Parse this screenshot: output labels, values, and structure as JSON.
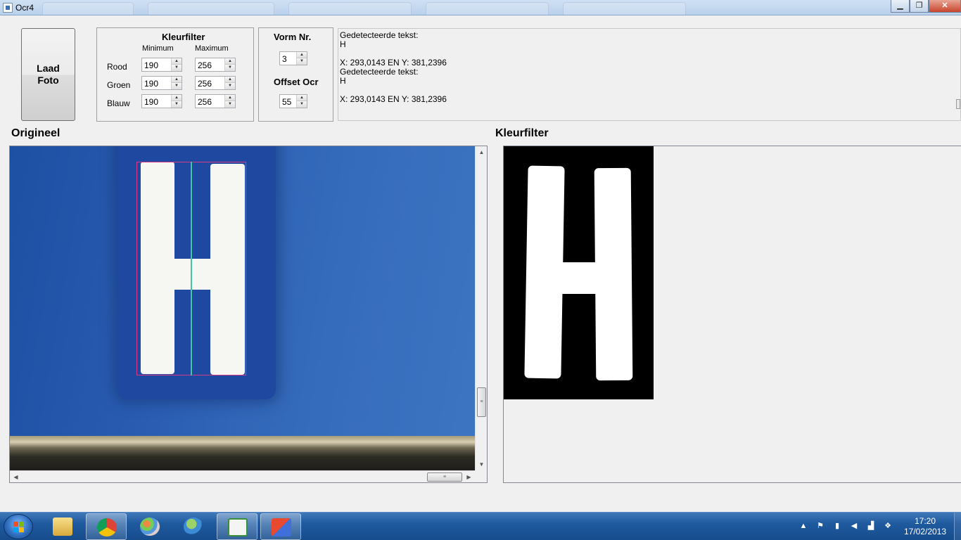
{
  "window": {
    "title": "Ocr4",
    "minimize": "▁",
    "restore": "❐",
    "close": "✕"
  },
  "load_button": {
    "line1": "Laad",
    "line2": "Foto"
  },
  "kleurfilter_group": {
    "title": "Kleurfilter",
    "min_header": "Minimum",
    "max_header": "Maximum",
    "rows": [
      {
        "label": "Rood",
        "min": "190",
        "max": "256"
      },
      {
        "label": "Groen",
        "min": "190",
        "max": "256"
      },
      {
        "label": "Blauw",
        "min": "190",
        "max": "256"
      }
    ]
  },
  "vorm_group": {
    "vorm_title": "Vorm Nr.",
    "vorm_value": "3",
    "offset_title": "Offset Ocr",
    "offset_value": "55"
  },
  "output": {
    "lines": [
      "Gedetecteerde tekst:",
      "H",
      "",
      "X: 293,0143 EN Y: 381,2396",
      "Gedetecteerde tekst:",
      "H",
      "",
      "X: 293,0143 EN Y: 381,2396"
    ]
  },
  "labels": {
    "original": "Origineel",
    "filter": "Kleurfilter"
  },
  "icons": {
    "spin_up": "▲",
    "spin_down": "▼",
    "scroll_up": "▲",
    "scroll_down": "▼",
    "scroll_left": "◀",
    "scroll_right": "▶",
    "grip": "≡"
  },
  "taskbar": {
    "time": "17:20",
    "date": "17/02/2013",
    "tray_expand": "▲",
    "apps": [
      "file-explorer-icon",
      "chrome-icon",
      "paint-icon",
      "users-icon",
      "csharp-icon",
      "ocr4-app-icon"
    ]
  },
  "colors": {
    "accent": "#1f5a9f",
    "bbox": "#d83a8a",
    "centerline": "#3fc8a0"
  }
}
